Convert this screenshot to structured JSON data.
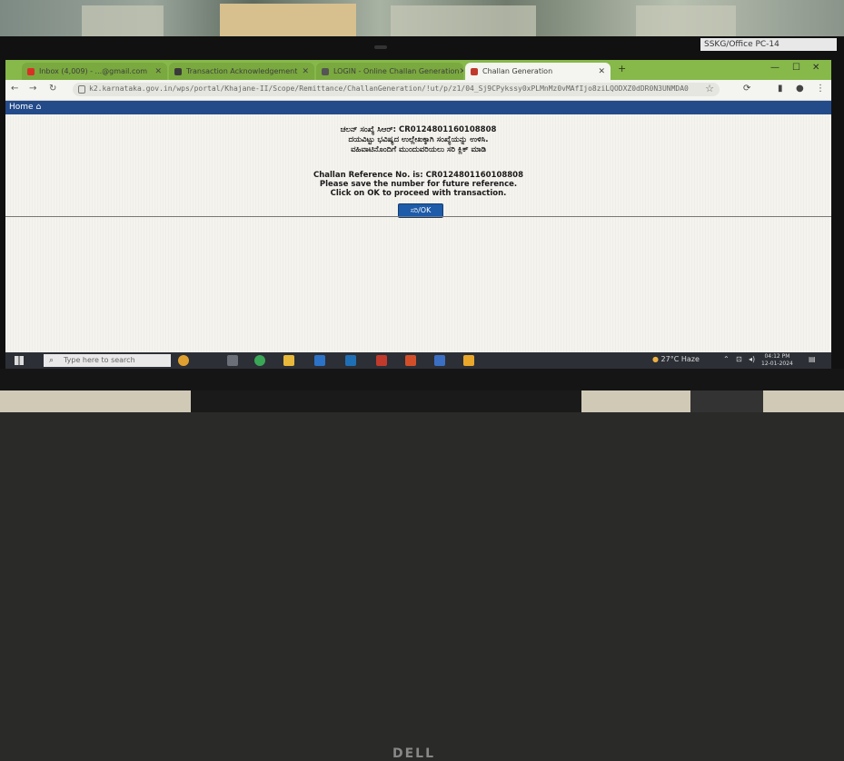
{
  "pc_label": "SSKG/Office PC-14",
  "browser": {
    "tabs": [
      {
        "label": "Inbox (4,009) - ...@gmail.com",
        "icon_color": "#d93025",
        "active": false
      },
      {
        "label": "Transaction Acknowledgement",
        "icon_color": "#3a3a3a",
        "active": false
      },
      {
        "label": "LOGIN - Online Challan Generation",
        "icon_color": "#555555",
        "active": false
      },
      {
        "label": "Challan Generation",
        "icon_color": "#c0392b",
        "active": true
      }
    ],
    "new_tab": "+",
    "address": "k2.karnataka.gov.in/wps/portal/Khajane-II/Scope/Remittance/ChallanGeneration/!ut/p/z1/04_Sj9CPykssy0xPLMnMz0vMAfIjo8ziLQODXZ0dDR0N3UNMDA0cvc2NDUNCnE0MjA30wwkpiAJKG-Ag4Gig..."
  },
  "app": {
    "home_label": "Home"
  },
  "message": {
    "line1": "ಚಲನ್ ಸಂಖ್ಯೆ ಸಿಆರ್: CR0124801160108808",
    "line2": "ದಯವಿಟ್ಟು ಭವಿಷ್ಯದ ಉಲ್ಲೇಖಕ್ಕಾಗಿ ಸಂಖ್ಯೆಯನ್ನು ಉಳಿಸಿ.",
    "line3": "ವಹಿವಾಟಿನೊಂದಿಗೆ ಮುಂದುವರಿಯಲು ಸರಿ ಕ್ಲಿಕ್ ಮಾಡಿ",
    "line4": "Challan Reference No. is: CR0124801160108808",
    "line5": "Please save the number for future reference.",
    "line6": "Click on OK to proceed with transaction."
  },
  "ok_button_label": "ಸರಿ/OK",
  "taskbar": {
    "search_placeholder": "Type here to search",
    "weather": "27°C Haze",
    "time": "04:12 PM",
    "date": "12-01-2024"
  },
  "monitor_brand": "DELL"
}
